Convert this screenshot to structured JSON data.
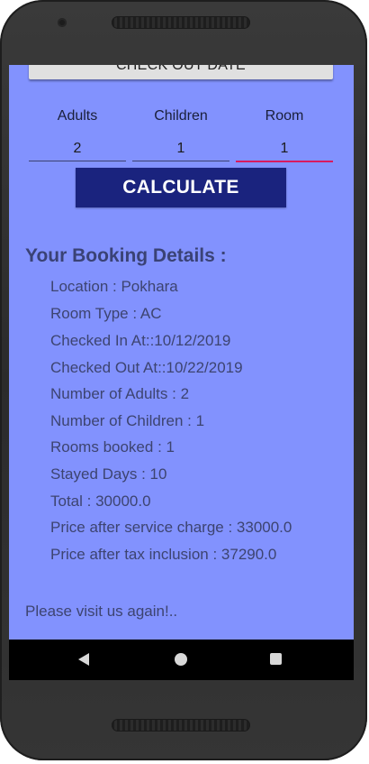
{
  "form": {
    "checkout_button_label": "CHECK OUT DATE",
    "adults_label": "Adults",
    "children_label": "Children",
    "room_label": "Room",
    "adults_value": "2",
    "children_value": "1",
    "room_value": "1",
    "calculate_label": "CALCULATE"
  },
  "details": {
    "title": "Your Booking Details :",
    "rows": [
      "Location : Pokhara",
      "Room Type : AC",
      "Checked In At::10/12/2019",
      "Checked Out At::10/22/2019",
      "Number of Adults : 2",
      "Number of Children : 1",
      "Rooms booked : 1",
      "Stayed Days : 10",
      "Total : 30000.0",
      "Price after service charge : 33000.0",
      "Price after tax inclusion : 37290.0"
    ]
  },
  "footer": {
    "message": "Please visit us again!.."
  },
  "colors": {
    "app_background": "#8292fe",
    "calculate_button": "#1a237e",
    "focused_underline": "#d81b60"
  },
  "navbar": {
    "back_icon": "back-triangle-icon",
    "home_icon": "home-circle-icon",
    "recents_icon": "recents-square-icon"
  }
}
